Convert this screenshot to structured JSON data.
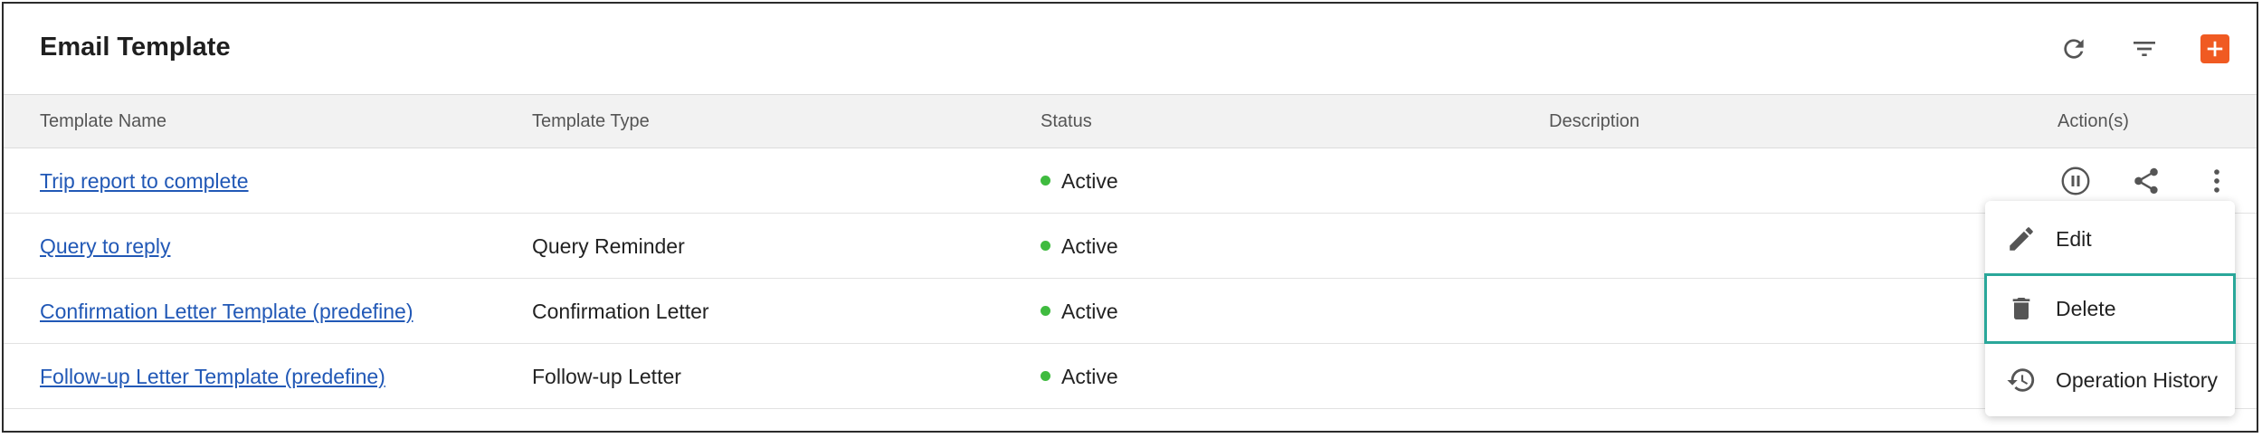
{
  "panel": {
    "title": "Email Template",
    "toolbar_icons": [
      "refresh-icon",
      "filter-icon",
      "add-icon"
    ],
    "accent_color": "#f05a22"
  },
  "table": {
    "headers": {
      "name": "Template Name",
      "type": "Template Type",
      "status": "Status",
      "description": "Description",
      "actions": "Action(s)"
    },
    "rows": [
      {
        "name": "Trip report to complete",
        "type": "",
        "status": "Active",
        "description": ""
      },
      {
        "name": "Query to reply",
        "type": "Query Reminder",
        "status": "Active",
        "description": ""
      },
      {
        "name": "Confirmation Letter Template (predefine)",
        "type": "Confirmation Letter",
        "status": "Active",
        "description": ""
      },
      {
        "name": "Follow-up Letter Template (predefine)",
        "type": "Follow-up Letter",
        "status": "Active",
        "description": ""
      }
    ],
    "status_color": "#3fbb3f",
    "row_action_icons": [
      "pause-icon",
      "share-icon",
      "more-vert-icon"
    ]
  },
  "context_menu": {
    "items": [
      {
        "label": "Edit",
        "icon": "pencil-icon"
      },
      {
        "label": "Delete",
        "icon": "trash-icon"
      },
      {
        "label": "Operation History",
        "icon": "history-icon"
      }
    ],
    "highlight_color": "#2aa79a"
  }
}
